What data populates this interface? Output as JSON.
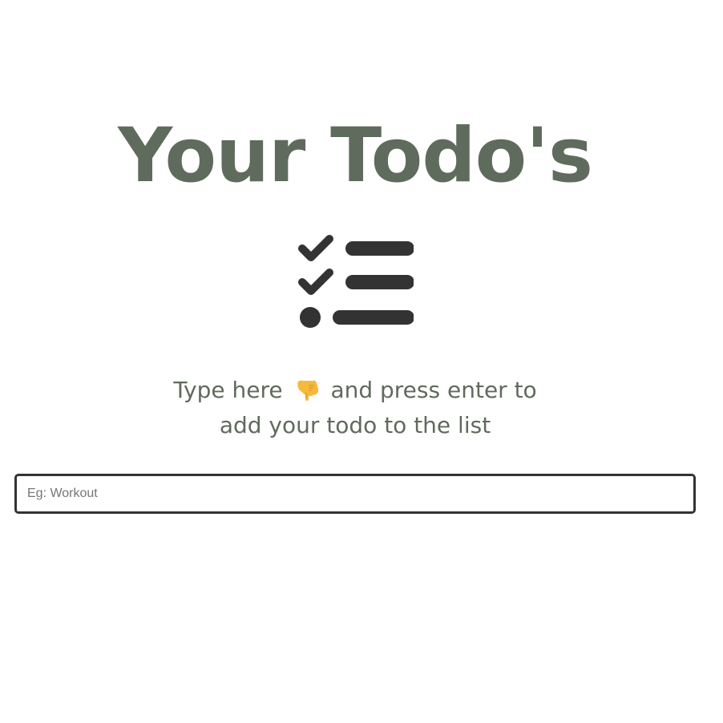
{
  "header": {
    "title": "Your Todo's"
  },
  "icons": {
    "list": "checklist-icon",
    "hand": "backhand-index-pointing-down-icon"
  },
  "hint": {
    "line1_before": "Type here",
    "line1_after": "and press enter to",
    "line2": "add your todo to the list"
  },
  "input": {
    "value": "",
    "placeholder": "Eg: Workout"
  },
  "colors": {
    "title": "#5f6b5c",
    "icon": "#333333",
    "input_border": "#333333",
    "hand": "#f6b93b"
  }
}
